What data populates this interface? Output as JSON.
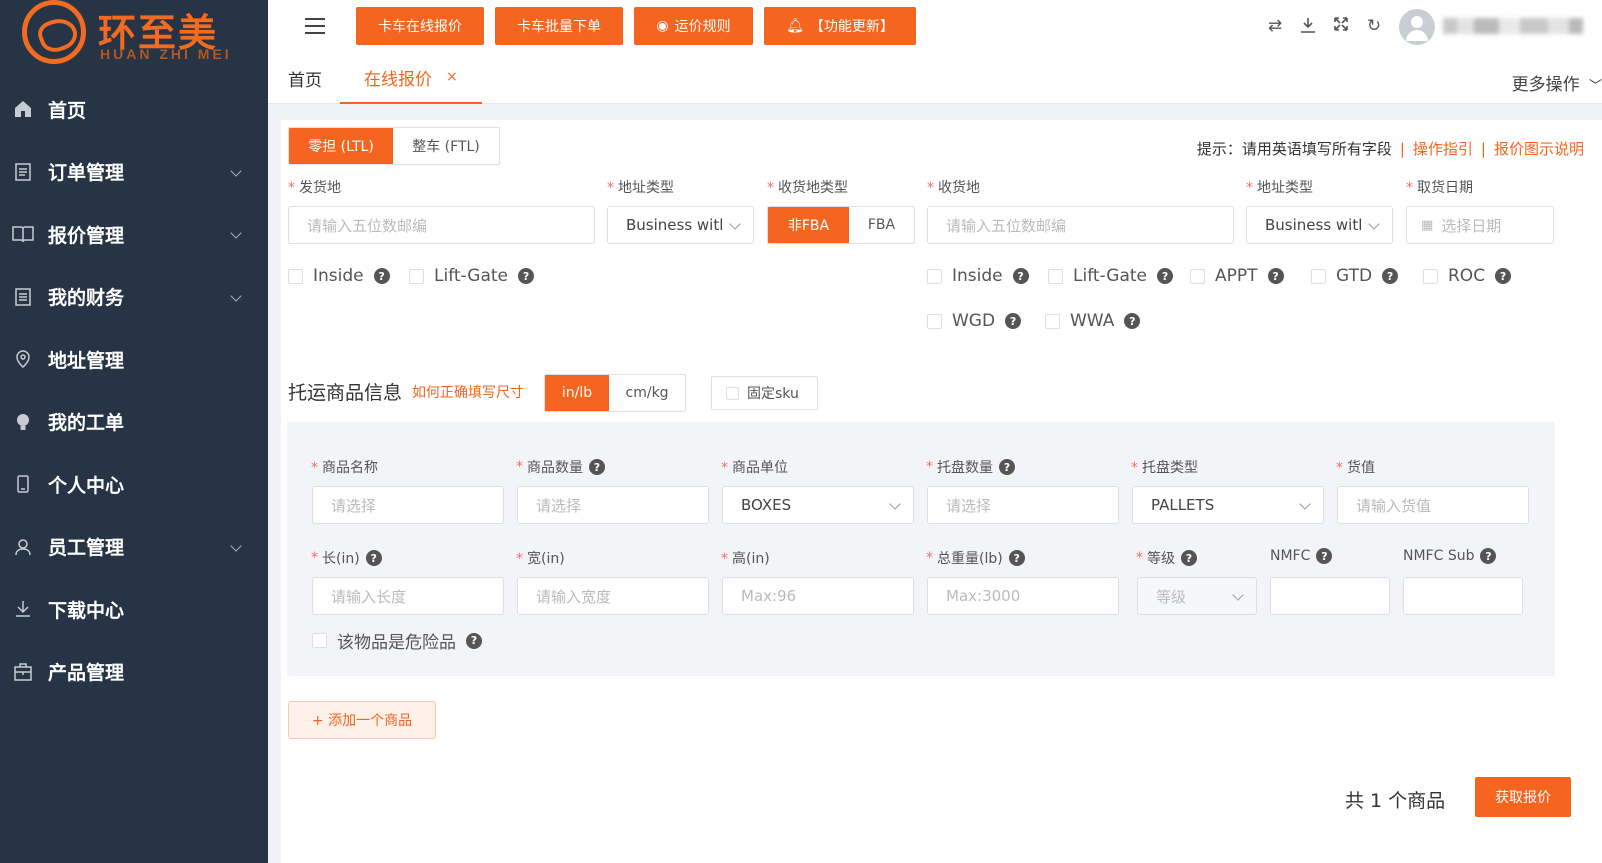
{
  "brand": {
    "name_cn": "环至美",
    "name_en": "HUAN ZHI MEI",
    "accent": "#f5651f"
  },
  "sidebar": {
    "items": [
      {
        "label": "首页",
        "icon": "home-icon"
      },
      {
        "label": "订单管理",
        "icon": "document-icon",
        "expandable": true
      },
      {
        "label": "报价管理",
        "icon": "book-icon",
        "expandable": true
      },
      {
        "label": "我的财务",
        "icon": "ledger-icon",
        "expandable": true
      },
      {
        "label": "地址管理",
        "icon": "location-icon"
      },
      {
        "label": "我的工单",
        "icon": "bulb-icon"
      },
      {
        "label": "个人中心",
        "icon": "phone-icon"
      },
      {
        "label": "员工管理",
        "icon": "user-icon",
        "expandable": true
      },
      {
        "label": "下载中心",
        "icon": "download-icon"
      },
      {
        "label": "产品管理",
        "icon": "box-icon"
      }
    ]
  },
  "toolbar": {
    "buttons": [
      "卡车在线报价",
      "卡车批量下单",
      "运价规则",
      "【功能更新】"
    ]
  },
  "tabs": {
    "home": "首页",
    "active": "在线报价",
    "close": "×",
    "more": "更多操作"
  },
  "form": {
    "modes": [
      "零担 (LTL)",
      "整车 (FTL)"
    ],
    "hint": {
      "text": "提示：请用英语填写所有字段",
      "link1": "操作指引",
      "link2": "报价图示说明"
    },
    "origin": {
      "label": "发货地",
      "placeholder": "请输入五位数邮编"
    },
    "origin_addr_type": {
      "label": "地址类型",
      "value": "Business witl"
    },
    "dest_type": {
      "label": "收货地类型",
      "options": [
        "非FBA",
        "FBA"
      ]
    },
    "dest": {
      "label": "收货地",
      "placeholder": "请输入五位数邮编"
    },
    "dest_addr_type": {
      "label": "地址类型",
      "value": "Business witl"
    },
    "pickup_date": {
      "label": "取货日期",
      "placeholder": "选择日期"
    },
    "origin_options": [
      "Inside",
      "Lift-Gate"
    ],
    "dest_options": [
      "Inside",
      "Lift-Gate",
      "APPT",
      "GTD",
      "ROC",
      "WGD",
      "WWA"
    ]
  },
  "goods": {
    "title": "托运商品信息",
    "help_link": "如何正确填写尺寸",
    "units": [
      "in/lb",
      "cm/kg"
    ],
    "fixed_sku": "固定sku",
    "fields": {
      "name": {
        "label": "商品名称",
        "placeholder": "请选择"
      },
      "qty": {
        "label": "商品数量",
        "placeholder": "请选择"
      },
      "unit": {
        "label": "商品单位",
        "value": "BOXES"
      },
      "pallet_qty": {
        "label": "托盘数量",
        "placeholder": "请选择"
      },
      "pallet_type": {
        "label": "托盘类型",
        "value": "PALLETS"
      },
      "value": {
        "label": "货值",
        "placeholder": "请输入货值"
      },
      "length": {
        "label": "长(in)",
        "placeholder": "请输入长度"
      },
      "width": {
        "label": "宽(in)",
        "placeholder": "请输入宽度"
      },
      "height": {
        "label": "高(in)",
        "placeholder": "Max:96"
      },
      "weight": {
        "label": "总重量(lb)",
        "placeholder": "Max:3000"
      },
      "grade": {
        "label": "等级",
        "placeholder": "等级"
      },
      "nmfc": {
        "label": "NMFC"
      },
      "nmfc_sub": {
        "label": "NMFC Sub"
      }
    },
    "hazmat": "该物品是危险品",
    "add_button": "+ 添加一个商品"
  },
  "footer": {
    "count": "共 1 个商品",
    "submit": "获取报价"
  }
}
